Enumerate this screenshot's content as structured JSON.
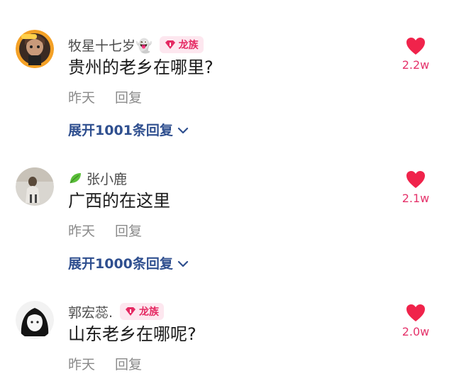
{
  "comments": [
    {
      "username": "牧星十七岁👻",
      "badge": "龙族",
      "text": "贵州的老乡在哪里?",
      "time": "昨天",
      "reply_label": "回复",
      "likes": "2.2w",
      "expand_label": "展开1001条回复"
    },
    {
      "username": "张小鹿",
      "text": "广西的在这里",
      "time": "昨天",
      "reply_label": "回复",
      "likes": "2.1w",
      "expand_label": "展开1000条回复"
    },
    {
      "username": "郭宏蕊.",
      "badge": "龙族",
      "text": "山东老乡在哪呢?",
      "time": "昨天",
      "reply_label": "回复",
      "likes": "2.0w"
    }
  ],
  "colors": {
    "heart": "#f0234b",
    "badge_text": "#e52a63",
    "badge_bg": "#fde7ef",
    "expand_link": "#2f4f8f",
    "meta_text": "#8a8a8a"
  },
  "icons": {
    "like": "heart-icon",
    "badge": "gem-icon",
    "expand": "chevron-down-icon",
    "name_prefix": "leaf-icon"
  }
}
